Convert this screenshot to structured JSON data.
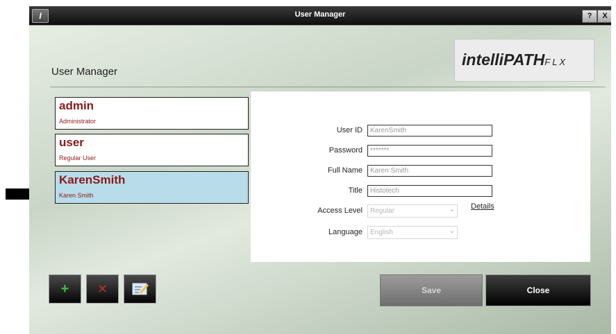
{
  "window": {
    "title": "User Manager"
  },
  "titlebar": {
    "help_label": "?",
    "close_label": "X"
  },
  "page": {
    "heading": "User Manager"
  },
  "logo": {
    "main": "intelliPATH",
    "suffix": "FLX"
  },
  "users": [
    {
      "name": "admin",
      "role": "Administrator",
      "selected": false
    },
    {
      "name": "user",
      "role": "Regular User",
      "selected": false
    },
    {
      "name": "KarenSmith",
      "role": "Karen Smith",
      "selected": true
    }
  ],
  "form": {
    "user_id_label": "User ID",
    "user_id_value": "KarenSmith",
    "password_label": "Password",
    "password_value": "*******",
    "full_name_label": "Full Name",
    "full_name_value": "Karen Smith",
    "title_label": "Title",
    "title_value": "Histotech",
    "access_level_label": "Access Level",
    "access_level_value": "Regular",
    "details_label": "Details",
    "language_label": "Language",
    "language_value": "English"
  },
  "buttons": {
    "save_label": "Save",
    "close_label": "Close"
  },
  "icons": {
    "add": "plus-icon",
    "delete": "x-icon",
    "edit": "edit-icon",
    "pointer": "arrow-icon",
    "dropdown": "chevron-down-icon"
  },
  "colors": {
    "username_text": "#8b1a1a",
    "selected_card": "#b8dcea",
    "add_icon": "#3fbf3f",
    "delete_icon": "#b73232"
  }
}
